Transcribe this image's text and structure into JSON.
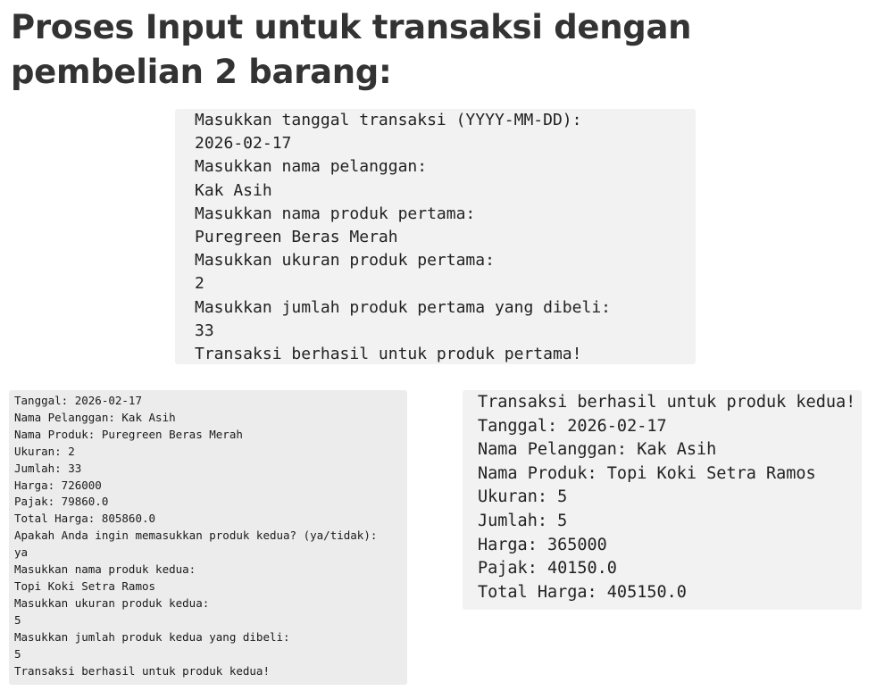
{
  "heading": "Proses Input untuk transaksi dengan pembelian 2 barang:",
  "console_top": {
    "lines": [
      "Masukkan tanggal transaksi (YYYY-MM-DD):",
      "2026-02-17",
      "Masukkan nama pelanggan:",
      "Kak Asih",
      "Masukkan nama produk pertama:",
      "Puregreen Beras Merah",
      "Masukkan ukuran produk pertama:",
      "2",
      "Masukkan jumlah produk pertama yang dibeli:",
      "33",
      "Transaksi berhasil untuk produk pertama!"
    ]
  },
  "console_left": {
    "lines": [
      "Tanggal: 2026-02-17",
      "Nama Pelanggan: Kak Asih",
      "Nama Produk: Puregreen Beras Merah",
      "Ukuran: 2",
      "Jumlah: 33",
      "Harga: 726000",
      "Pajak: 79860.0",
      "Total Harga: 805860.0",
      "Apakah Anda ingin memasukkan produk kedua? (ya/tidak):",
      "ya",
      "Masukkan nama produk kedua:",
      "Topi Koki Setra Ramos",
      "Masukkan ukuran produk kedua:",
      "5",
      "Masukkan jumlah produk kedua yang dibeli:",
      "5",
      "Transaksi berhasil untuk produk kedua!"
    ]
  },
  "console_right": {
    "lines": [
      "Transaksi berhasil untuk produk kedua!",
      "Tanggal: 2026-02-17",
      "Nama Pelanggan: Kak Asih",
      "Nama Produk: Topi Koki Setra Ramos",
      "Ukuran: 5",
      "Jumlah: 5",
      "Harga: 365000",
      "Pajak: 40150.0",
      "Total Harga: 405150.0"
    ]
  }
}
